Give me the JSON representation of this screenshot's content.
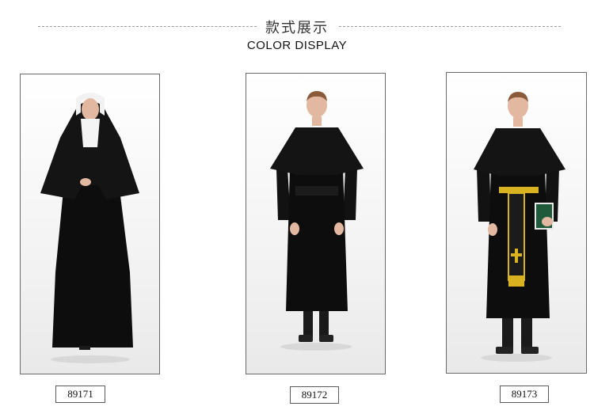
{
  "header": {
    "title_zh": "款式展示",
    "title_en": "COLOR DISPLAY"
  },
  "products": [
    {
      "code": "89171",
      "figure": "nun-costume"
    },
    {
      "code": "89172",
      "figure": "priest-costume"
    },
    {
      "code": "89173",
      "figure": "priest-costume-with-stole"
    }
  ],
  "colors": {
    "garment": "#111111",
    "skin": "#e2b8a0",
    "hair": "#8a5a3a",
    "gold": "#d9b21f",
    "book": "#1f5a3a"
  }
}
